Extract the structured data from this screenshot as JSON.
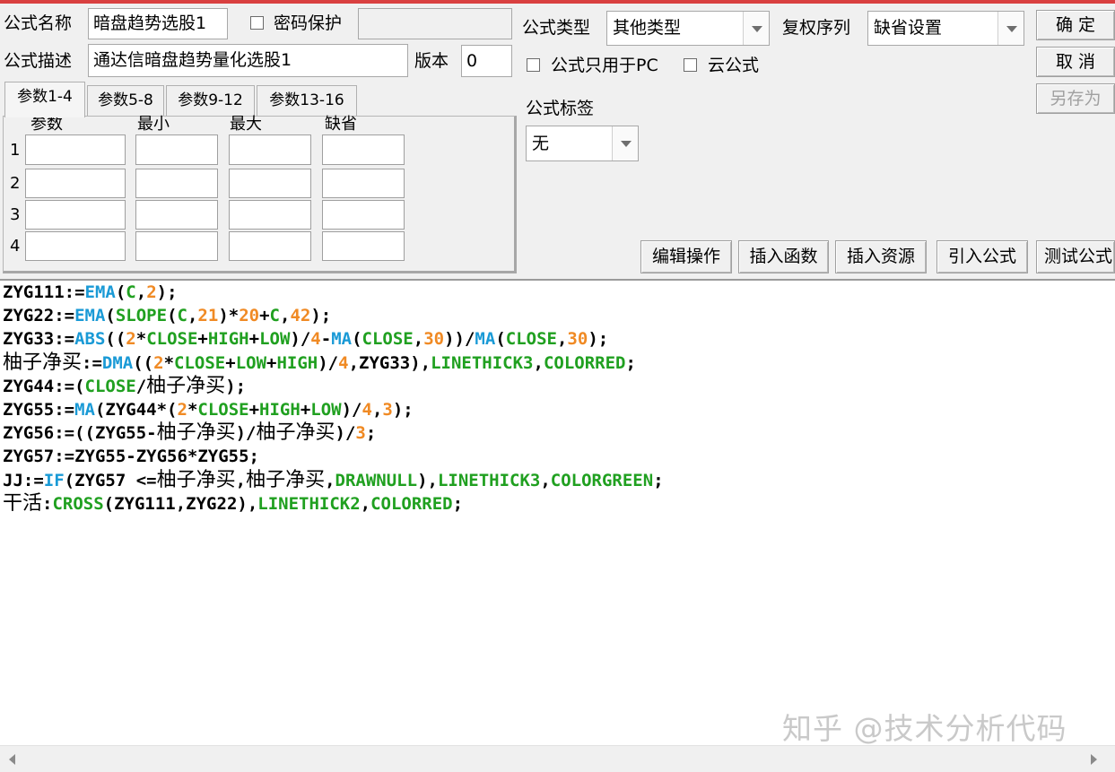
{
  "window": {
    "accent_color": "#d94040"
  },
  "form": {
    "name_label": "公式名称",
    "name_value": "暗盘趋势选股1",
    "password_label": "密码保护",
    "password_value": "",
    "desc_label": "公式描述",
    "desc_value": "通达信暗盘趋势量化选股1",
    "version_label": "版本",
    "version_value": "0",
    "type_label": "公式类型",
    "type_value": "其他类型",
    "adjust_label": "复权序列",
    "adjust_value": "缺省设置",
    "pc_only_label": "公式只用于PC",
    "cloud_label": "云公式",
    "tag_label": "公式标签",
    "tag_value": "无"
  },
  "buttons": {
    "ok": "确 定",
    "cancel": "取 消",
    "save_as": "另存为",
    "edit_ops": "编辑操作",
    "insert_func": "插入函数",
    "insert_res": "插入资源",
    "import_formula": "引入公式",
    "test_formula": "测试公式"
  },
  "params": {
    "tabs": [
      "参数1-4",
      "参数5-8",
      "参数9-12",
      "参数13-16"
    ],
    "columns": [
      "参数",
      "最小",
      "最大",
      "缺省"
    ],
    "rows": [
      "1",
      "2",
      "3",
      "4"
    ]
  },
  "code": {
    "colors": {
      "default": "#000000",
      "function": "#1a9ad6",
      "keyword": "#20a020",
      "number": "#f08a24"
    },
    "lines": [
      [
        [
          "ZYG111:=",
          "d"
        ],
        [
          "EMA",
          "f"
        ],
        [
          "(",
          "d"
        ],
        [
          "C",
          "k"
        ],
        [
          ",",
          "d"
        ],
        [
          "2",
          "n"
        ],
        [
          ");",
          "d"
        ]
      ],
      [
        [
          "ZYG22:=",
          "d"
        ],
        [
          "EMA",
          "f"
        ],
        [
          "(",
          "d"
        ],
        [
          "SLOPE",
          "k"
        ],
        [
          "(",
          "d"
        ],
        [
          "C",
          "k"
        ],
        [
          ",",
          "d"
        ],
        [
          "21",
          "n"
        ],
        [
          ")*",
          "d"
        ],
        [
          "20",
          "n"
        ],
        [
          "+",
          "d"
        ],
        [
          "C",
          "k"
        ],
        [
          ",",
          "d"
        ],
        [
          "42",
          "n"
        ],
        [
          ");",
          "d"
        ]
      ],
      [
        [
          "ZYG33:=",
          "d"
        ],
        [
          "ABS",
          "f"
        ],
        [
          "((",
          "d"
        ],
        [
          "2",
          "n"
        ],
        [
          "*",
          "d"
        ],
        [
          "CLOSE",
          "k"
        ],
        [
          "+",
          "d"
        ],
        [
          "HIGH",
          "k"
        ],
        [
          "+",
          "d"
        ],
        [
          "LOW",
          "k"
        ],
        [
          ")/",
          "d"
        ],
        [
          "4",
          "n"
        ],
        [
          "-",
          "d"
        ],
        [
          "MA",
          "f"
        ],
        [
          "(",
          "d"
        ],
        [
          "CLOSE",
          "k"
        ],
        [
          ",",
          "d"
        ],
        [
          "30",
          "n"
        ],
        [
          "))/",
          "d"
        ],
        [
          "MA",
          "f"
        ],
        [
          "(",
          "d"
        ],
        [
          "CLOSE",
          "k"
        ],
        [
          ",",
          "d"
        ],
        [
          "30",
          "n"
        ],
        [
          ");",
          "d"
        ]
      ],
      [
        [
          "柚子净买",
          "c"
        ],
        [
          ":=",
          "d"
        ],
        [
          "DMA",
          "f"
        ],
        [
          "((",
          "d"
        ],
        [
          "2",
          "n"
        ],
        [
          "*",
          "d"
        ],
        [
          "CLOSE",
          "k"
        ],
        [
          "+",
          "d"
        ],
        [
          "LOW",
          "k"
        ],
        [
          "+",
          "d"
        ],
        [
          "HIGH",
          "k"
        ],
        [
          ")/",
          "d"
        ],
        [
          "4",
          "n"
        ],
        [
          ",ZYG33),",
          "d"
        ],
        [
          "LINETHICK3",
          "k"
        ],
        [
          ",",
          "d"
        ],
        [
          "COLORRED",
          "k"
        ],
        [
          ";",
          "d"
        ]
      ],
      [
        [
          "ZYG44:=(",
          "d"
        ],
        [
          "CLOSE",
          "k"
        ],
        [
          "/",
          "d"
        ],
        [
          "柚子净买",
          "c"
        ],
        [
          ");",
          "d"
        ]
      ],
      [
        [
          "ZYG55:=",
          "d"
        ],
        [
          "MA",
          "f"
        ],
        [
          "(ZYG44*(",
          "d"
        ],
        [
          "2",
          "n"
        ],
        [
          "*",
          "d"
        ],
        [
          "CLOSE",
          "k"
        ],
        [
          "+",
          "d"
        ],
        [
          "HIGH",
          "k"
        ],
        [
          "+",
          "d"
        ],
        [
          "LOW",
          "k"
        ],
        [
          ")/",
          "d"
        ],
        [
          "4",
          "n"
        ],
        [
          ",",
          "d"
        ],
        [
          "3",
          "n"
        ],
        [
          ");",
          "d"
        ]
      ],
      [
        [
          "ZYG56:=((ZYG55-",
          "d"
        ],
        [
          "柚子净买",
          "c"
        ],
        [
          ")/",
          "d"
        ],
        [
          "柚子净买",
          "c"
        ],
        [
          ")/",
          "d"
        ],
        [
          "3",
          "n"
        ],
        [
          ";",
          "d"
        ]
      ],
      [
        [
          "ZYG57:=ZYG55-ZYG56*ZYG55;",
          "d"
        ]
      ],
      [
        [
          "JJ:=",
          "d"
        ],
        [
          "IF",
          "f"
        ],
        [
          "(ZYG57 <=",
          "d"
        ],
        [
          "柚子净买",
          "c"
        ],
        [
          ",",
          "d"
        ],
        [
          "柚子净买",
          "c"
        ],
        [
          ",",
          "d"
        ],
        [
          "DRAWNULL",
          "k"
        ],
        [
          "),",
          "d"
        ],
        [
          "LINETHICK3",
          "k"
        ],
        [
          ",",
          "d"
        ],
        [
          "COLORGREEN",
          "k"
        ],
        [
          ";",
          "d"
        ]
      ],
      [
        [
          "干活",
          "c"
        ],
        [
          ":",
          "d"
        ],
        [
          "CROSS",
          "k"
        ],
        [
          "(ZYG111,ZYG22),",
          "d"
        ],
        [
          "LINETHICK2",
          "k"
        ],
        [
          ",",
          "d"
        ],
        [
          "COLORRED",
          "k"
        ],
        [
          ";",
          "d"
        ]
      ]
    ]
  },
  "watermark": "知乎 @技术分析代码"
}
